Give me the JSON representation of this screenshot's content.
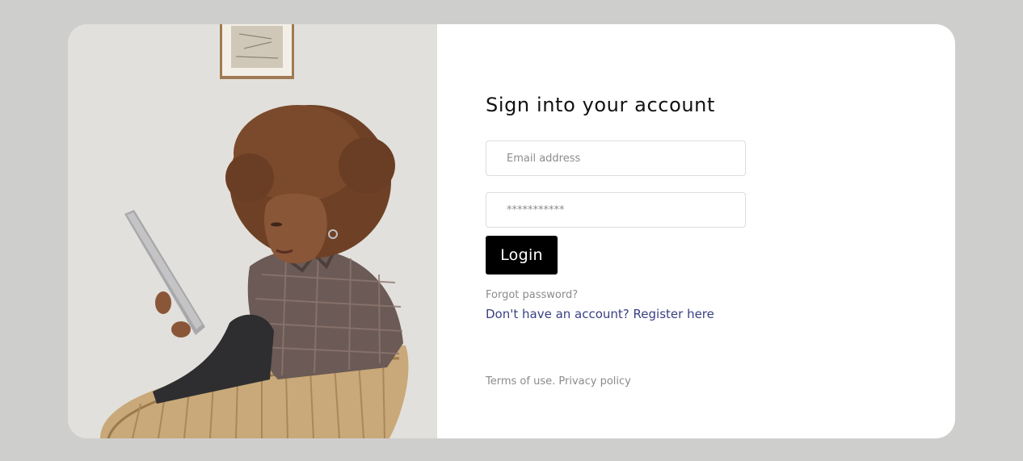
{
  "form": {
    "title": "Sign into your account",
    "email_placeholder": "Email address",
    "password_placeholder": "***********",
    "login_label": "Login",
    "forgot_password": "Forgot password?",
    "register_prompt": "Don't have an account? ",
    "register_link": "Register here",
    "terms": "Terms of use.",
    "privacy": "Privacy policy"
  },
  "colors": {
    "page_background": "#cececd",
    "card_background": "#ffffff",
    "button_background": "#000000",
    "link_accent": "#393f81",
    "muted_text": "#8b8b8b"
  }
}
